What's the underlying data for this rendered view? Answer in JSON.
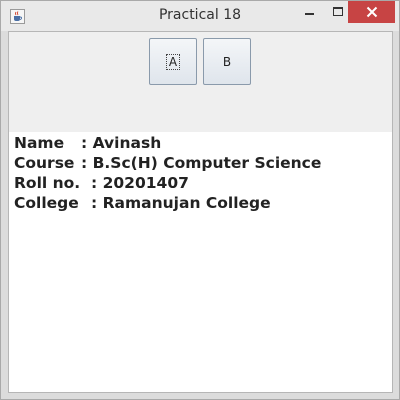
{
  "window": {
    "title": "Practical 18",
    "icon": "java-cup-icon"
  },
  "buttons": {
    "a_label": "A",
    "b_label": "B"
  },
  "info": {
    "name_label": "Name",
    "name_sep": ": ",
    "name_value": "Avinash",
    "course_label": "Course",
    "course_sep": ": ",
    "course_value": "B.Sc(H) Computer Science",
    "roll_label": "Roll no.",
    "roll_sep": ": ",
    "roll_value": "20201407",
    "college_label": "College",
    "college_sep": ": ",
    "college_value": "Ramanujan College"
  }
}
